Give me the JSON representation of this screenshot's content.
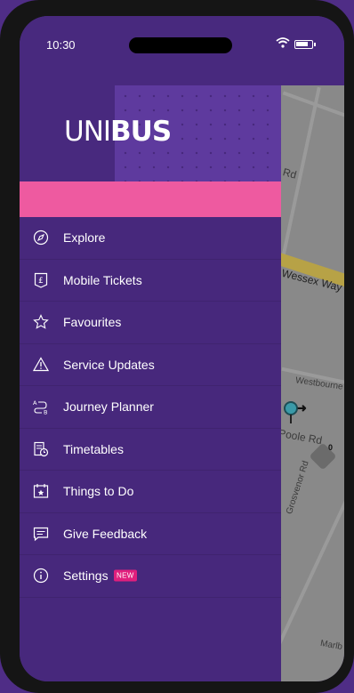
{
  "status_bar": {
    "time": "10:30"
  },
  "brand": {
    "logo_light": "UNI",
    "logo_bold": "BUS"
  },
  "menu": {
    "items": [
      {
        "label": "Explore",
        "icon": "compass-icon"
      },
      {
        "label": "Mobile Tickets",
        "icon": "ticket-icon"
      },
      {
        "label": "Favourites",
        "icon": "star-icon"
      },
      {
        "label": "Service Updates",
        "icon": "warning-icon"
      },
      {
        "label": "Journey Planner",
        "icon": "route-icon"
      },
      {
        "label": "Timetables",
        "icon": "timetable-icon"
      },
      {
        "label": "Things to Do",
        "icon": "calendar-icon"
      },
      {
        "label": "Give Feedback",
        "icon": "feedback-icon"
      },
      {
        "label": "Settings",
        "icon": "info-icon",
        "badge": "NEW"
      }
    ]
  },
  "map": {
    "labels": [
      "Rd",
      "Wessex Way",
      "Westbourne",
      "Poole Rd",
      "Grosvenor Rd",
      "Marlb"
    ],
    "bike_count": "0"
  },
  "colors": {
    "drawer": "#47287c",
    "accent_pink": "#ee5aa0",
    "badge": "#e01f7d",
    "pattern": "#5e3a9e"
  }
}
